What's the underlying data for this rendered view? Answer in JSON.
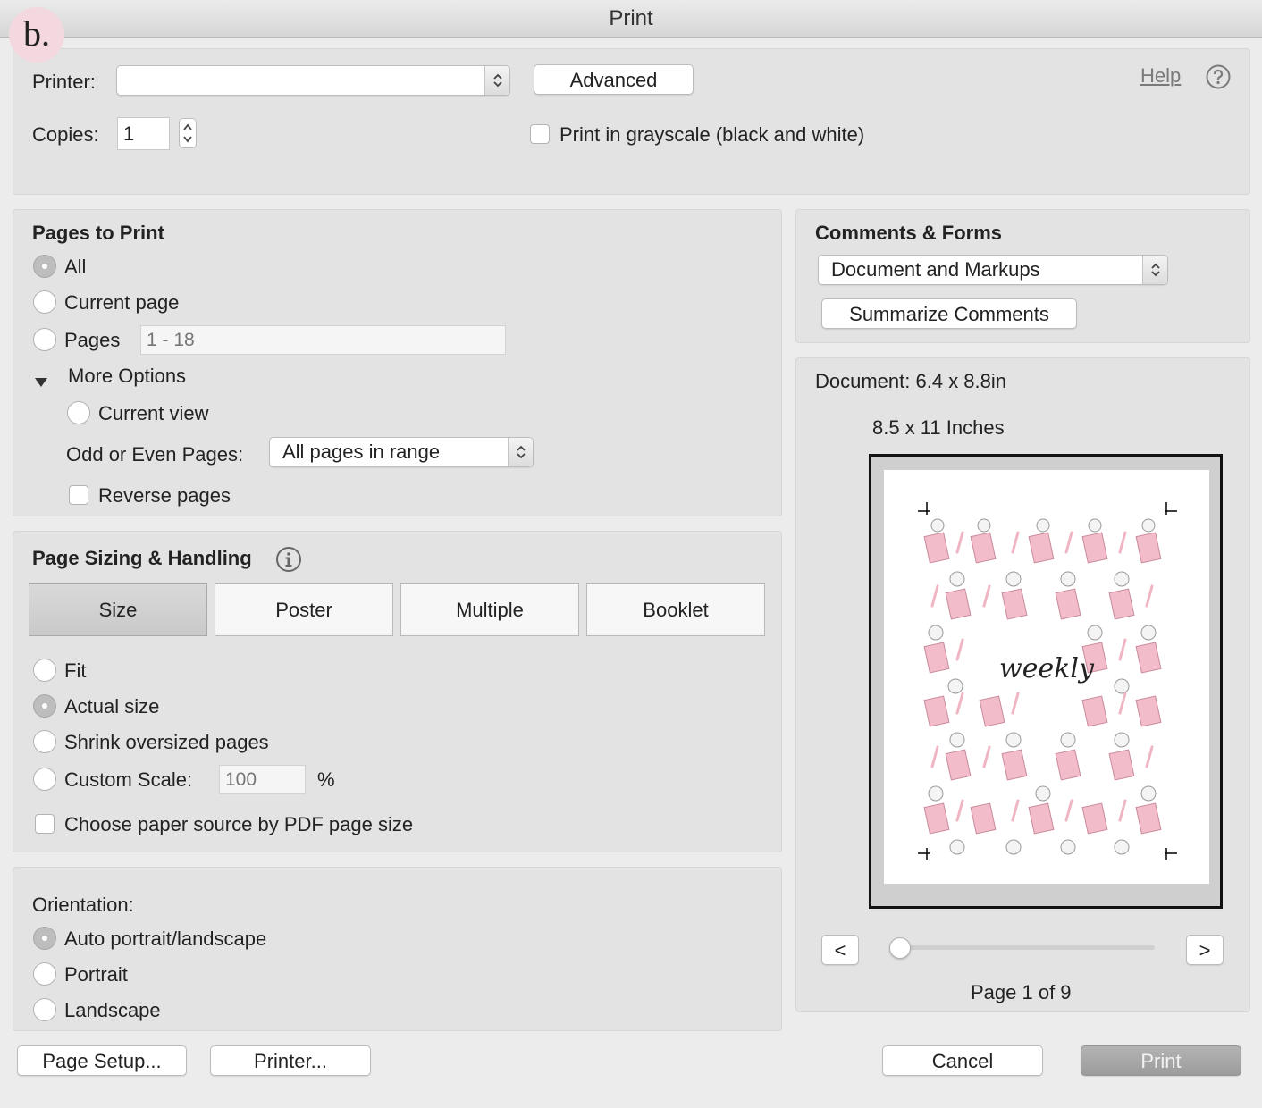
{
  "window": {
    "title": "Print",
    "badge": "b."
  },
  "top": {
    "printer_label": "Printer:",
    "printer_value": "",
    "advanced_label": "Advanced",
    "help_label": "Help",
    "copies_label": "Copies:",
    "copies_value": "1",
    "grayscale_label": "Print in grayscale (black and white)",
    "grayscale_checked": false
  },
  "pages_to_print": {
    "heading": "Pages to Print",
    "options": [
      {
        "label": "All",
        "selected": true
      },
      {
        "label": "Current page",
        "selected": false
      },
      {
        "label": "Pages",
        "selected": false
      }
    ],
    "pages_placeholder": "1 - 18",
    "more_options_label": "More Options",
    "current_view_label": "Current view",
    "odd_even_label": "Odd or Even Pages:",
    "odd_even_value": "All pages in range",
    "reverse_label": "Reverse pages"
  },
  "comments_forms": {
    "heading": "Comments & Forms",
    "select_value": "Document and Markups",
    "summarize_label": "Summarize Comments"
  },
  "preview": {
    "document_size": "Document: 6.4 x 8.8in",
    "paper_size": "8.5 x 11 Inches",
    "preview_text": "weekly",
    "prev_label": "<",
    "next_label": ">",
    "page_indicator": "Page 1 of 9",
    "current_page": 1,
    "total_pages": 9
  },
  "page_sizing": {
    "heading": "Page Sizing & Handling",
    "tabs": [
      "Size",
      "Poster",
      "Multiple",
      "Booklet"
    ],
    "active_tab": "Size",
    "options": [
      {
        "label": "Fit",
        "selected": false
      },
      {
        "label": "Actual size",
        "selected": true
      },
      {
        "label": "Shrink oversized pages",
        "selected": false
      },
      {
        "label": "Custom Scale:",
        "selected": false
      }
    ],
    "custom_scale_placeholder": "100",
    "percent": "%",
    "paper_source_label": "Choose paper source by PDF page size"
  },
  "orientation": {
    "heading": "Orientation:",
    "options": [
      {
        "label": "Auto portrait/landscape",
        "selected": true
      },
      {
        "label": "Portrait",
        "selected": false
      },
      {
        "label": "Landscape",
        "selected": false
      }
    ]
  },
  "footer": {
    "page_setup_label": "Page Setup...",
    "printer_label": "Printer...",
    "cancel_label": "Cancel",
    "print_label": "Print"
  },
  "colors": {
    "accent_pink": "#f2bcca",
    "print_button": "#a6a6a6"
  }
}
